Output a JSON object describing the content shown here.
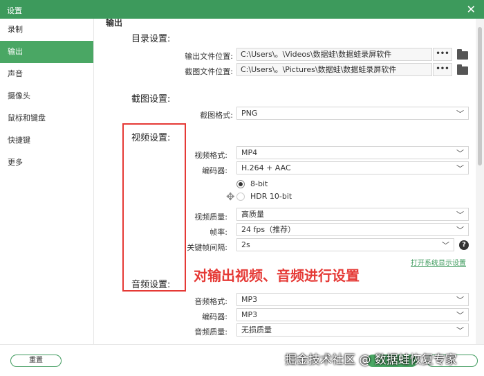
{
  "window": {
    "title": "设置",
    "close_glyph": "✕"
  },
  "sidebar": {
    "items": [
      {
        "label": "录制"
      },
      {
        "label": "输出"
      },
      {
        "label": "声音"
      },
      {
        "label": "摄像头"
      },
      {
        "label": "鼠标和键盘"
      },
      {
        "label": "快捷键"
      },
      {
        "label": "更多"
      }
    ],
    "active_index": 1
  },
  "output": {
    "heading": "输出",
    "directory": {
      "title": "目录设置:",
      "output_label": "输出文件位置:",
      "output_path": "C:\\Users\\。\\Videos\\数据蛙\\数据蛙录屏软件",
      "screenshot_label": "截图文件位置:",
      "screenshot_path": "C:\\Users\\。\\Pictures\\数据蛙\\数据蛙录屏软件",
      "browse_label": "•••"
    },
    "screenshot": {
      "title": "截图设置:",
      "format_label": "截图格式:",
      "format_value": "PNG"
    },
    "video": {
      "title": "视频设置:",
      "format_label": "视频格式:",
      "format_value": "MP4",
      "encoder_label": "编码器:",
      "encoder_value": "H.264 + AAC",
      "bit_options": [
        "8-bit",
        "HDR 10-bit"
      ],
      "selected_bit": "8-bit",
      "quality_label": "视频质量:",
      "quality_value": "高质量",
      "fps_label": "帧率:",
      "fps_value": "24 fps（推荐）",
      "keyframe_label": "关键帧间隔:",
      "keyframe_value": "2s",
      "help_glyph": "?",
      "display_settings_link": "打开系统显示设置"
    },
    "audio": {
      "title": "音频设置:",
      "format_label": "音频格式:",
      "format_value": "MP3",
      "encoder_label": "编码器:",
      "encoder_value": "MP3",
      "quality_label": "音频质量:",
      "quality_value": "无损质量"
    }
  },
  "annotation": {
    "text": "对输出视频、音频进行设置",
    "color": "#e53935"
  },
  "footer": {
    "reset_label": "重置",
    "watermark": "掘金技术社区 @ 数据蛙恢复专家"
  },
  "colors": {
    "accent": "#4aa764",
    "titlebar": "#3d9a5c"
  },
  "icons": {
    "dropdown": "chevron-down-icon",
    "folder": "folder-icon",
    "move": "move-cursor-icon"
  }
}
